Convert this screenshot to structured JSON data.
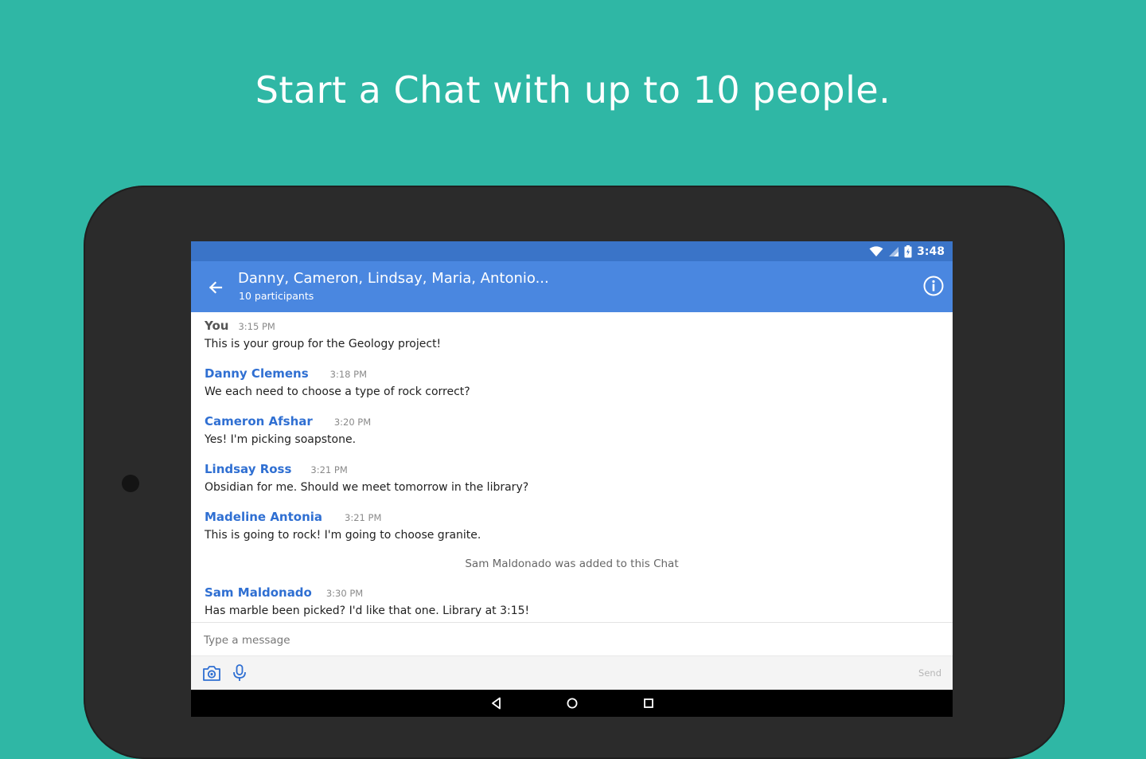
{
  "promo": {
    "headline": "Start a Chat with up to 10 people."
  },
  "status_bar": {
    "time": "3:48",
    "icons": [
      "wifi-icon",
      "signal-icon",
      "battery-icon"
    ]
  },
  "app_bar": {
    "back_icon": "arrow-left-icon",
    "title": "Danny, Cameron, Lindsay, Maria, Antonio...",
    "subtitle": "10 participants",
    "info_icon": "info-icon"
  },
  "messages": [
    {
      "sender": "You",
      "time": "3:15 PM",
      "text": "This is your group for the Geology project!"
    },
    {
      "sender": "Danny Clemens",
      "time": "3:18 PM",
      "text": "We each need to choose a type of rock correct?"
    },
    {
      "sender": "Cameron Afshar",
      "time": "3:20 PM",
      "text": "Yes! I'm picking soapstone."
    },
    {
      "sender": "Lindsay Ross",
      "time": "3:21 PM",
      "text": "Obsidian for me. Should we meet tomorrow in the library?"
    },
    {
      "sender": "Madeline Antonia",
      "time": "3:21 PM",
      "text": "This is going to rock! I'm going to choose granite."
    },
    {
      "sender": "Sam Maldonado",
      "time": "3:30 PM",
      "text": "Has marble been picked? I'd like that one. Library at 3:15!"
    }
  ],
  "system_message": "Sam Maldonado was added to this Chat",
  "composer": {
    "placeholder": "Type a message",
    "value": "",
    "send_label": "Send",
    "camera_icon": "camera-icon",
    "mic_icon": "microphone-icon"
  },
  "colors": {
    "background": "#2fb7a5",
    "status_bar": "#3a74c8",
    "app_bar": "#4a87e0",
    "sender_name": "#2f6fd2",
    "device_frame": "#2b2b2b"
  },
  "nav_bar": {
    "icons": [
      "back-triangle-icon",
      "home-circle-icon",
      "recents-square-icon"
    ]
  }
}
